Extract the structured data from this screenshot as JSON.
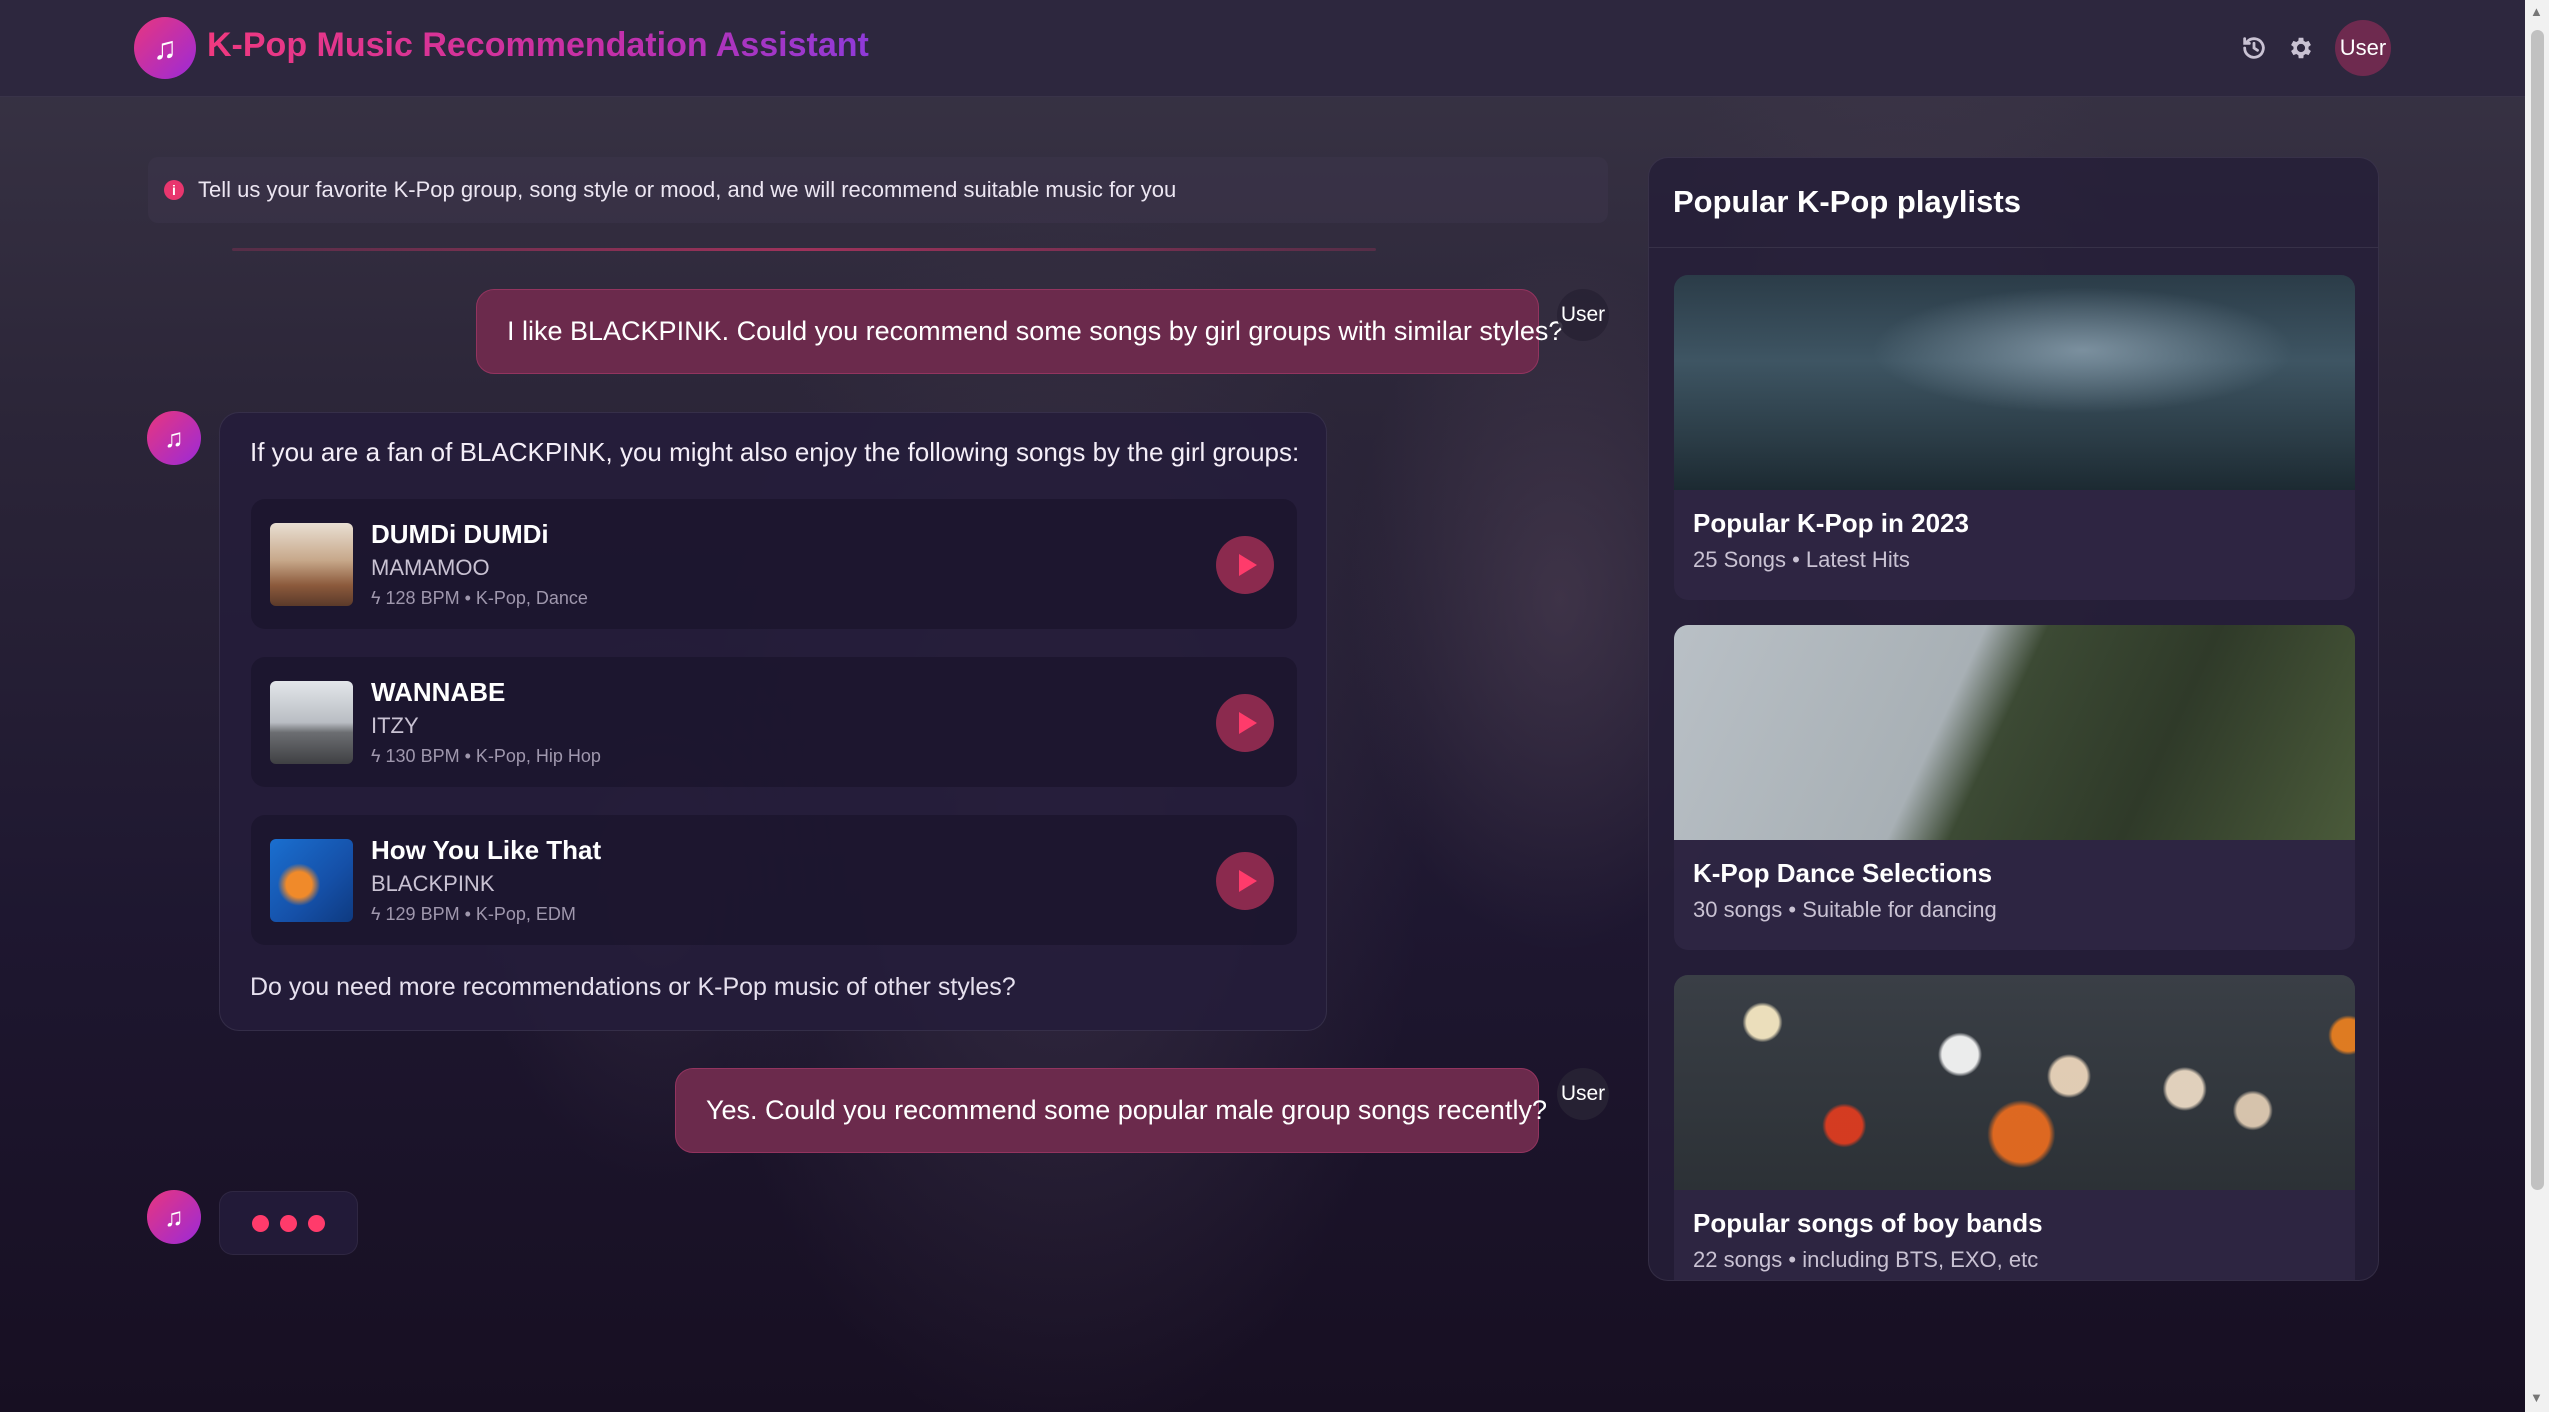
{
  "header": {
    "title": "K-Pop Music Recommendation Assistant",
    "user_label": "User",
    "icons": [
      "music-note-icon",
      "history-icon",
      "gear-icon"
    ]
  },
  "notice": {
    "text": "Tell us your favorite K-Pop group, song style or mood, and we will recommend suitable music for you",
    "icon": "info-icon"
  },
  "chat": {
    "user_label": "User",
    "message1": "I like BLACKPINK. Could you recommend some songs by girl groups with similar styles?",
    "bot_intro": "If you are a fan of BLACKPINK, you might also enjoy the following songs by the girl groups:",
    "songs": [
      {
        "title": "DUMDi DUMDi",
        "artist": "MAMAMOO",
        "meta": "128 BPM  •  K-Pop, Dance"
      },
      {
        "title": "WANNABE",
        "artist": "ITZY",
        "meta": "130 BPM  •  K-Pop, Hip Hop"
      },
      {
        "title": "How You Like That",
        "artist": "BLACKPINK",
        "meta": "129 BPM  •  K-Pop, EDM"
      }
    ],
    "bot_outro": "Do you need more recommendations or K-Pop music of other styles?",
    "message2": "Yes. Could you recommend some popular male group songs recently?"
  },
  "sidebar": {
    "title": "Popular K-Pop playlists",
    "playlists": [
      {
        "title": "Popular K-Pop in 2023",
        "sub": "25 Songs • Latest Hits"
      },
      {
        "title": "K-Pop Dance Selections",
        "sub": "30 songs • Suitable for dancing"
      },
      {
        "title": "Popular songs of boy bands",
        "sub": "22 songs • including BTS, EXO, etc"
      }
    ]
  },
  "colors": {
    "accent": "#e8367e",
    "accent_purple": "#9b2ad8",
    "user_bubble": "#6b2a4c",
    "play": "#ff3b6b"
  }
}
